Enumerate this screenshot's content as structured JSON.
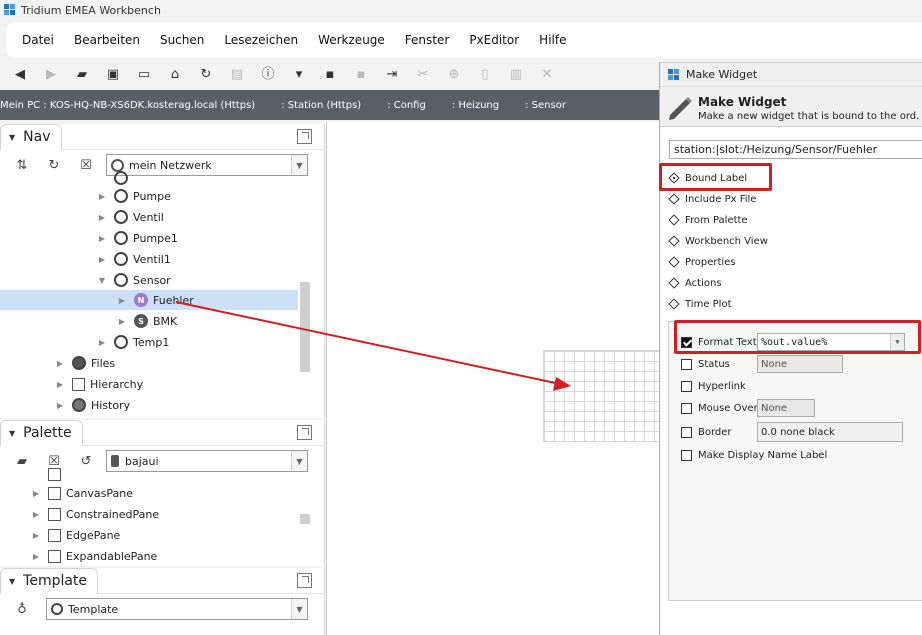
{
  "window": {
    "title": "Tridium EMEA Workbench"
  },
  "menu": [
    "Datei",
    "Bearbeiten",
    "Suchen",
    "Lesezeichen",
    "Werkzeuge",
    "Fenster",
    "PxEditor",
    "Hilfe"
  ],
  "breadcrumb": [
    "Mein PC : KOS-HQ-NB-XS6DK.kosterag.local (Https)",
    ": Station (Https)",
    ": Config",
    ": Heizung",
    ": Sensor"
  ],
  "nav": {
    "tab_label": "Nav",
    "network_combo": "mein Netzwerk",
    "tree": [
      {
        "label": "Pumpe",
        "icon": "folder-circle-icon"
      },
      {
        "label": "Ventil",
        "icon": "folder-circle-icon"
      },
      {
        "label": "Pumpe1",
        "icon": "folder-circle-icon"
      },
      {
        "label": "Ventil1",
        "icon": "folder-circle-icon"
      },
      {
        "label": "Sensor",
        "icon": "folder-circle-icon"
      },
      {
        "label": "Fuehler",
        "icon": "numeric-point-icon",
        "badge": "N"
      },
      {
        "label": "BMK",
        "icon": "string-point-icon",
        "badge": "S"
      },
      {
        "label": "Temp1",
        "icon": "folder-circle-icon"
      },
      {
        "label": "Files",
        "icon": "files-icon"
      },
      {
        "label": "Hierarchy",
        "icon": "hierarchy-icon"
      },
      {
        "label": "History",
        "icon": "history-icon"
      }
    ]
  },
  "palette": {
    "tab_label": "Palette",
    "module_combo": "bajaui",
    "items": [
      "CanvasPane",
      "ConstrainedPane",
      "EdgePane",
      "ExpandablePane"
    ]
  },
  "template": {
    "tab_label": "Template",
    "combo": "Template"
  },
  "dialog": {
    "window_title": "Make Widget",
    "header_title": "Make Widget",
    "header_subtitle": "Make a new widget that is bound to the ord.",
    "ord": "station:|slot:/Heizung/Sensor/Fuehler",
    "options": [
      "Bound Label",
      "Include Px File",
      "From Palette",
      "Workbench View",
      "Properties",
      "Actions",
      "Time Plot"
    ],
    "selected_option": "Bound Label",
    "settings": {
      "format_text_label": "Format Text",
      "format_text_value": "%out.value%",
      "status_label": "Status",
      "status_value": "None",
      "hyperlink_label": "Hyperlink",
      "mouse_over_label": "Mouse Over",
      "mouse_over_value": "None",
      "border_label": "Border",
      "border_value": "0.0 none black",
      "display_name_label": "Make Display Name Label"
    }
  },
  "colors": {
    "highlight_red": "#d21e1e",
    "breadcrumb_bg": "#5a5f66",
    "tree_selected": "#cce1f7"
  }
}
